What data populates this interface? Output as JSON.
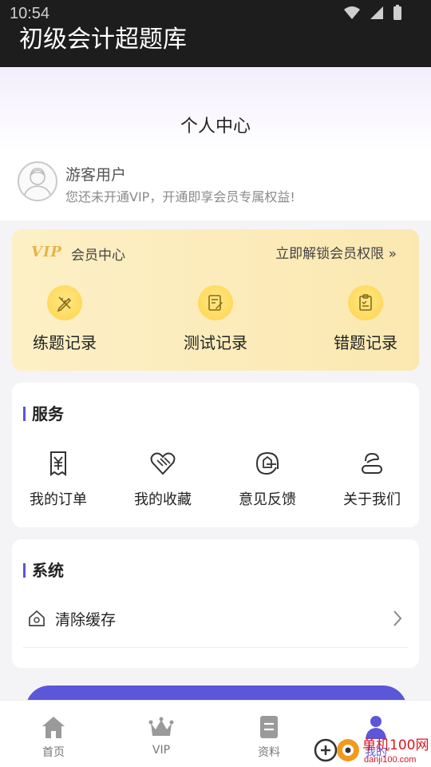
{
  "status_bar": {
    "time": "10:54"
  },
  "app_title": "初级会计超题库",
  "page_title": "个人中心",
  "user": {
    "name": "游客用户",
    "subtitle": "您还未开通VIP，开通即享会员专属权益!"
  },
  "vip_card": {
    "logo_text": "VIP",
    "center_label": "会员中心",
    "unlock_label": "立即解锁会员权限 »",
    "items": [
      {
        "label": "练题记录",
        "icon": "pencil-ruler-icon"
      },
      {
        "label": "测试记录",
        "icon": "edit-document-icon"
      },
      {
        "label": "错题记录",
        "icon": "clipboard-check-icon"
      }
    ]
  },
  "services": {
    "title": "服务",
    "items": [
      {
        "label": "我的订单",
        "icon": "yen-receipt-icon"
      },
      {
        "label": "我的收藏",
        "icon": "broken-heart-icon"
      },
      {
        "label": "意见反馈",
        "icon": "feedback-icon"
      },
      {
        "label": "关于我们",
        "icon": "about-icon"
      }
    ]
  },
  "system": {
    "title": "系统",
    "rows": [
      {
        "label": "清除缓存",
        "icon": "home-outline-icon"
      }
    ]
  },
  "bottom_nav": {
    "items": [
      {
        "label": "首页",
        "icon": "home-icon",
        "active": false
      },
      {
        "label": "VIP",
        "icon": "crown-icon",
        "active": false
      },
      {
        "label": "资料",
        "icon": "document-icon",
        "active": false
      },
      {
        "label": "我的",
        "icon": "person-icon",
        "active": true
      }
    ]
  },
  "watermark": {
    "text": "单机100网",
    "url_text": "danji100.com"
  },
  "colors": {
    "accent": "#5b57d8",
    "vip_gold": "#fde9b5",
    "app_bar": "#1d1d1d"
  }
}
